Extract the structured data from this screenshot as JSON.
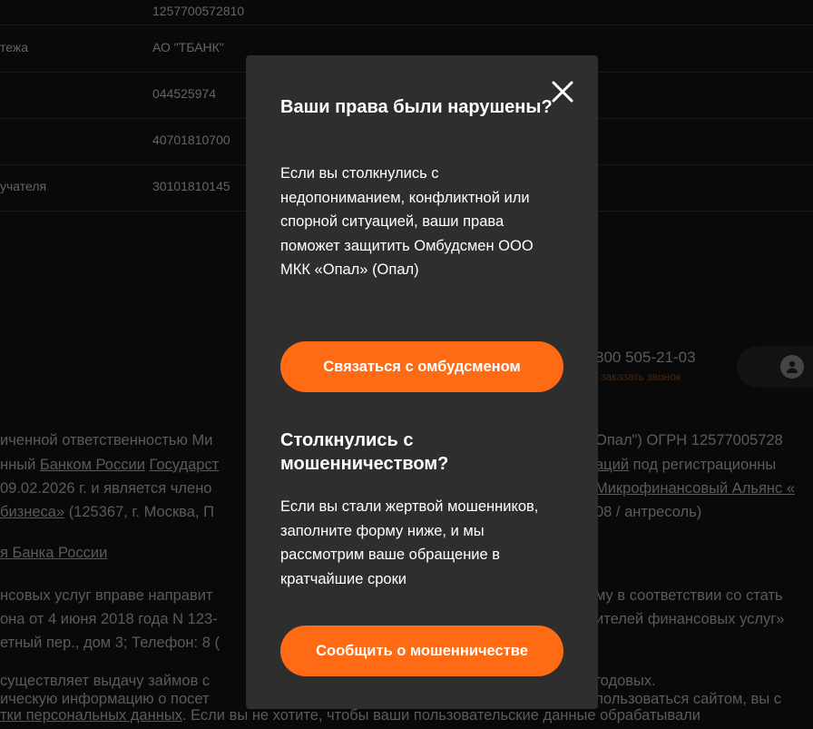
{
  "requisites": {
    "rows": [
      {
        "label": "",
        "value": "1257700572810"
      },
      {
        "label": "тежа",
        "value": "АО \"ТБАНК\""
      },
      {
        "label": "",
        "value": "044525974"
      },
      {
        "label": "",
        "value": "40701810700"
      },
      {
        "label": "учателя",
        "value": "30101810145"
      }
    ]
  },
  "contacts": {
    "phone": "800 505-21-03",
    "callback": "заказать звонок"
  },
  "footer": {
    "l1": "иченной ответственностью Ми",
    "l1r": "Опал\") ОГРН 12577005728",
    "l2a": "нный ",
    "l2b": "Банком России",
    "l2c": " ",
    "l2d": "Государст",
    "l2r1": "аций",
    "l2r2": " под регистрационны",
    "l3": "09.02.2026 г. и является члено",
    "l3r": "Микрофинансовый Альянс «",
    "l4a": " бизнеса»",
    "l4b": " (125367, г. Москва, П",
    "l4r": "08 / антресоль)",
    "l5": "я Банка России",
    "l6": "нсовых услуг вправе направит",
    "l6r": "му в соответствии со стать",
    "l7": "она от 4 июня 2018 года N 123-",
    "l7r": "ителей финансовых услуг»",
    "l8": "етный пер., дом 3; Телефон: 8 (",
    "l9": "существляет выдачу займов с",
    "l9r": "годовых.",
    "l10": "ическую информацию о посет",
    "l10r": "пользоваться сайтом, вы с",
    "l11a": "тки персональных данных",
    "l11b": ". Если вы не хотите, чтобы ваши пользовательские данные обрабатывали"
  },
  "modal": {
    "title1": "Ваши права были нарушены?",
    "text1": "Если вы столкнулись с недопониманием, конфликтной или спорной ситуацией, ваши права поможет защитить Омбудсмен ООО МКК «Опал» (Опал)",
    "button1": "Связаться с омбудсменом",
    "title2": "Столкнулись с мошенничеством?",
    "text2": "Если вы стали жертвой мошенников, заполните форму ниже, и мы рассмотрим ваше обращение в кратчайшие сроки",
    "button2": "Сообщить о мошенничестве",
    "accent_color": "#ff6a14"
  }
}
